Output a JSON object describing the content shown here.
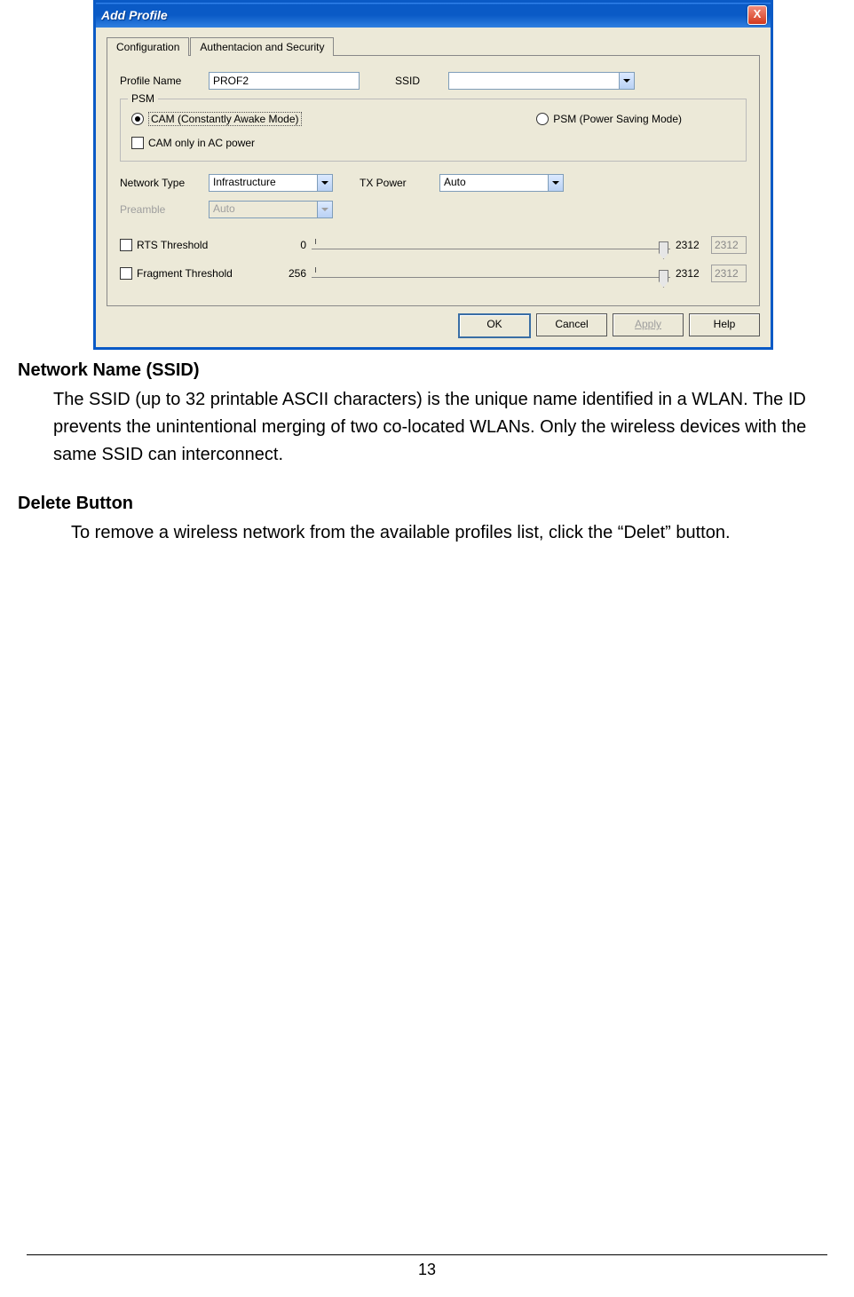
{
  "dialog": {
    "title": "Add Profile",
    "tabs": {
      "t1": "Configuration",
      "t2": "Authentacion and Security"
    },
    "profile_name_label": "Profile Name",
    "profile_name_value": "PROF2",
    "ssid_label": "SSID",
    "ssid_value": "",
    "psm": {
      "group": "PSM",
      "cam": "CAM (Constantly Awake Mode)",
      "psm": "PSM (Power Saving Mode)",
      "cam_ac": "CAM only in AC power"
    },
    "network_type_label": "Network Type",
    "network_type_value": "Infrastructure",
    "tx_power_label": "TX Power",
    "tx_power_value": "Auto",
    "preamble_label": "Preamble",
    "preamble_value": "Auto",
    "rts_label": "RTS Threshold",
    "rts_min": "0",
    "rts_max": "2312",
    "rts_val": "2312",
    "frag_label": "Fragment Threshold",
    "frag_min": "256",
    "frag_max": "2312",
    "frag_val": "2312",
    "buttons": {
      "ok": "OK",
      "cancel": "Cancel",
      "apply": "Apply",
      "help": "Help"
    }
  },
  "doc": {
    "h1": "Network Name (SSID)",
    "p1": "The SSID (up to 32 printable ASCII characters) is the unique name identified in a WLAN. The ID prevents the unintentional merging of two co-located WLANs. Only the wireless devices with the same SSID can interconnect.",
    "h2": "Delete Button",
    "p2": "To remove a wireless network from the available profiles list, click the “Delet” button.",
    "page": "13"
  }
}
